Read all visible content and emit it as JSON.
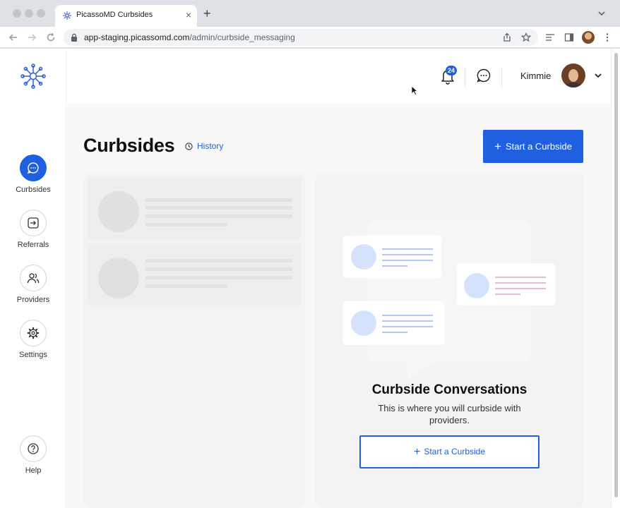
{
  "browser": {
    "tab_title": "PicassoMD Curbsides",
    "new_tab_symbol": "+",
    "close_symbol": "×",
    "url_host": "app-staging.picassomd.com",
    "url_path": "/admin/curbside_messaging"
  },
  "sidebar": {
    "items": [
      {
        "label": "Curbsides",
        "icon": "chat-bubble-icon",
        "active": true
      },
      {
        "label": "Referrals",
        "icon": "arrow-in-square-icon",
        "active": false
      },
      {
        "label": "Providers",
        "icon": "users-icon",
        "active": false
      },
      {
        "label": "Settings",
        "icon": "gear-icon",
        "active": false
      }
    ],
    "help_label": "Help"
  },
  "header": {
    "notification_count": "24",
    "user_name": "Kimmie"
  },
  "page": {
    "title": "Curbsides",
    "history_label": "History",
    "start_button_label": "Start a Curbside"
  },
  "empty_state": {
    "title": "Curbside Conversations",
    "subtitle": "This is where you will curbside with providers.",
    "button_label": "Start a Curbside"
  },
  "colors": {
    "accent": "#1f5fe0",
    "panel": "#f3f3f3",
    "skeleton": "#e0e0e0"
  }
}
